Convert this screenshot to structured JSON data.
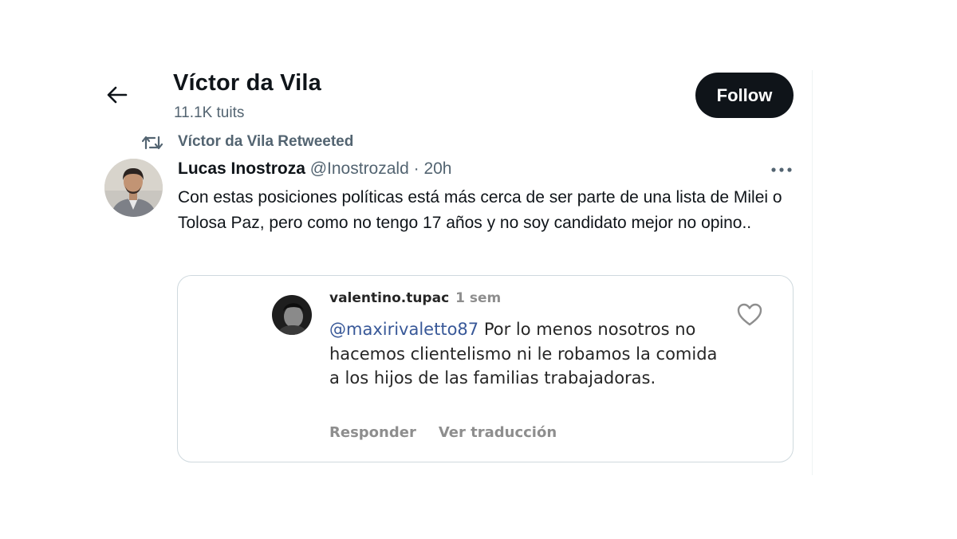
{
  "header": {
    "back_icon": "arrow-left-icon",
    "profile_name": "Víctor da Vila",
    "tweet_count": "11.1K tuits",
    "follow_label": "Follow"
  },
  "retweet": {
    "icon": "retweet-icon",
    "text": "Víctor da Vila Retweeted"
  },
  "tweet": {
    "author_name": "Lucas Inostroza",
    "author_handle": "@Inostrozald",
    "separator": "·",
    "time": "20h",
    "more_icon": "more-dots-icon",
    "text": "Con estas posiciones políticas está más cerca de ser parte de una lista de Milei o Tolosa Paz, pero como no tengo 17 años y no soy candidato mejor no opino.."
  },
  "embedded_comment": {
    "username": "valentino.tupac",
    "time": "1 sem",
    "mention": "@maxirivaletto87",
    "text": "Por lo menos nosotros no hacemos clientelismo ni le robamos la comida a los hijos de las familias trabajadoras.",
    "reply_label": "Responder",
    "translate_label": "Ver traducción",
    "heart_icon": "heart-outline-icon"
  },
  "colors": {
    "text_primary": "#0f1419",
    "text_secondary": "#536471",
    "follow_bg": "#0f1419",
    "card_border": "#cfd9de",
    "mention_blue": "#385898",
    "ig_gray": "#8e8e8e"
  }
}
